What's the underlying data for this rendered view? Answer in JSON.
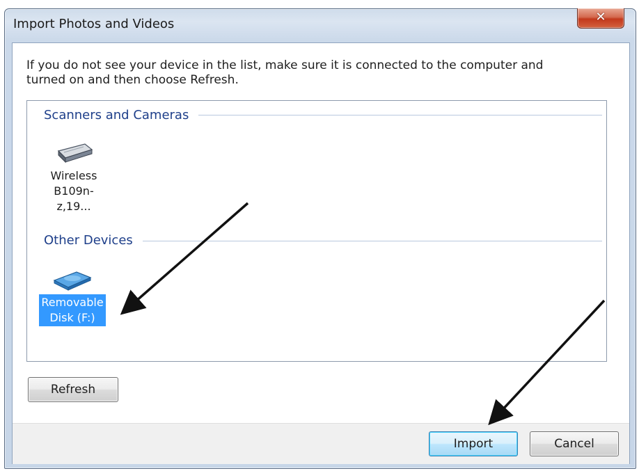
{
  "window": {
    "title": "Import Photos and Videos",
    "close_glyph": "✕"
  },
  "instruction": "If you do not see your device in the list, make sure it is connected to the computer and turned on and then choose Refresh.",
  "groups": [
    {
      "header": "Scanners and Cameras",
      "devices": [
        {
          "label_line1": "Wireless",
          "label_line2": "B109n-z,19...",
          "icon": "scanner-icon",
          "selected": false
        }
      ]
    },
    {
      "header": "Other Devices",
      "devices": [
        {
          "label_line1": "Removable",
          "label_line2": "Disk (F:)",
          "icon": "removable-disk-icon",
          "selected": true
        }
      ]
    }
  ],
  "buttons": {
    "refresh": "Refresh",
    "import": "Import",
    "cancel": "Cancel"
  },
  "colors": {
    "selection": "#3399ff",
    "group_header": "#1e3f8a",
    "default_button_border": "#3c7fb1"
  }
}
